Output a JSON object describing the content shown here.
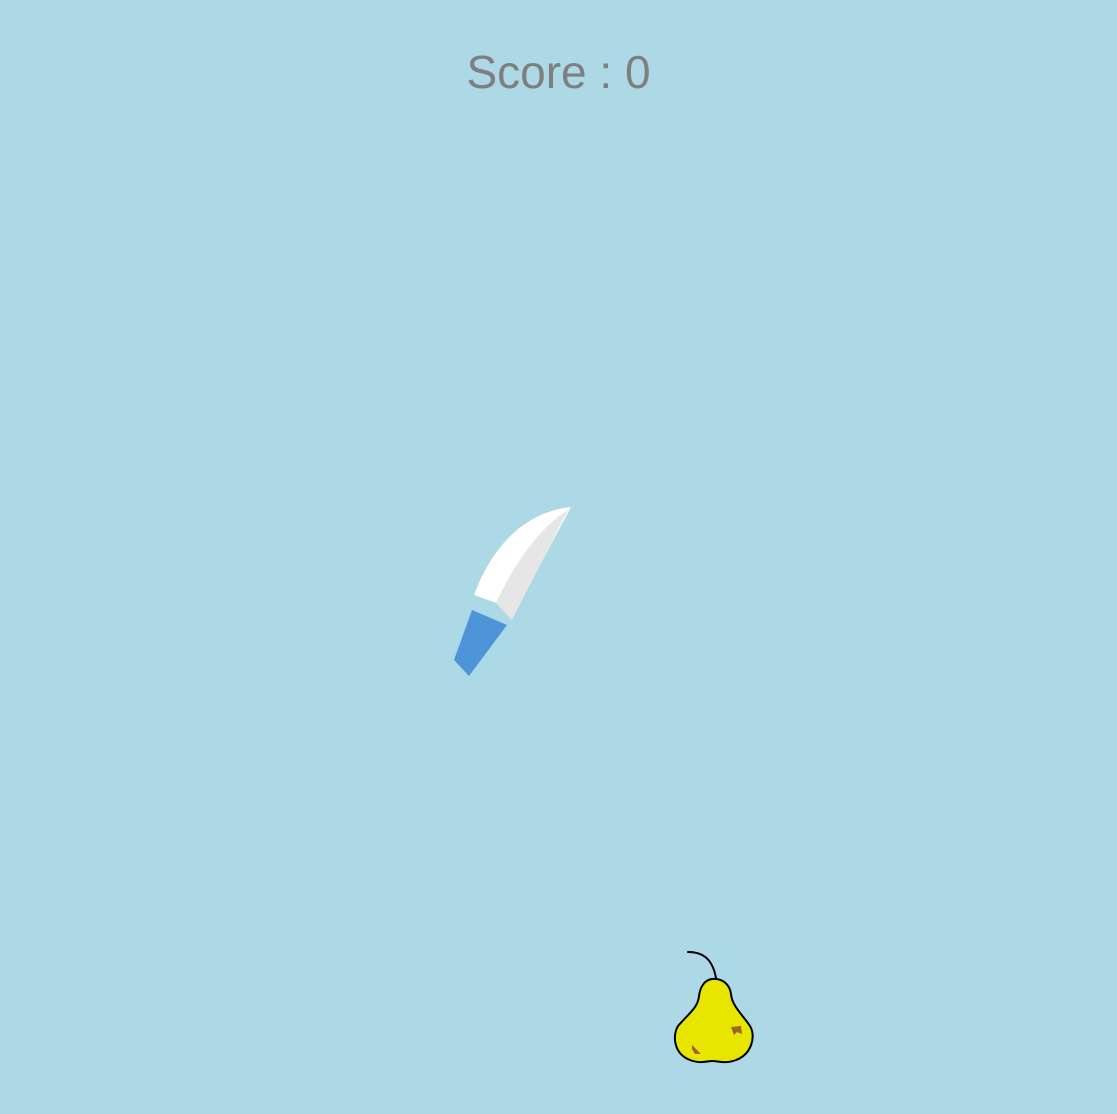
{
  "scene": {
    "background_color": "#add8e6",
    "score_color": "#7f7f7f"
  },
  "hud": {
    "score_label": "Score",
    "score_separator": " : ",
    "score_value": 0
  },
  "knife": {
    "icon": "kitchen-knife-icon",
    "blade_color": "#ffffff",
    "blade_shade_color": "#e6e6e6",
    "handle_color": "#4d94d8"
  },
  "fruit": {
    "type": "pear",
    "icon": "pear-icon",
    "body_color": "#e8e600",
    "outline_color": "#000000",
    "stem_color": "#000000",
    "spot_color": "#a0642a"
  }
}
